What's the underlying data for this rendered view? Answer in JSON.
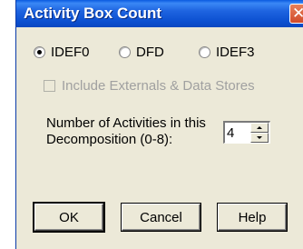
{
  "window": {
    "title": "Activity Box Count"
  },
  "method": {
    "options": [
      {
        "label": "IDEF0",
        "checked": true
      },
      {
        "label": "DFD",
        "checked": false
      },
      {
        "label": "IDEF3",
        "checked": false
      }
    ]
  },
  "externals": {
    "label": "Include Externals & Data Stores",
    "checked": false,
    "enabled": false
  },
  "count": {
    "label": "Number of Activities in this Decomposition (0-8):",
    "value": "4"
  },
  "buttons": {
    "ok": "OK",
    "cancel": "Cancel",
    "help": "Help"
  },
  "icons": {
    "close": "close-icon",
    "spin_up": "spin-up-icon",
    "spin_down": "spin-down-icon"
  }
}
